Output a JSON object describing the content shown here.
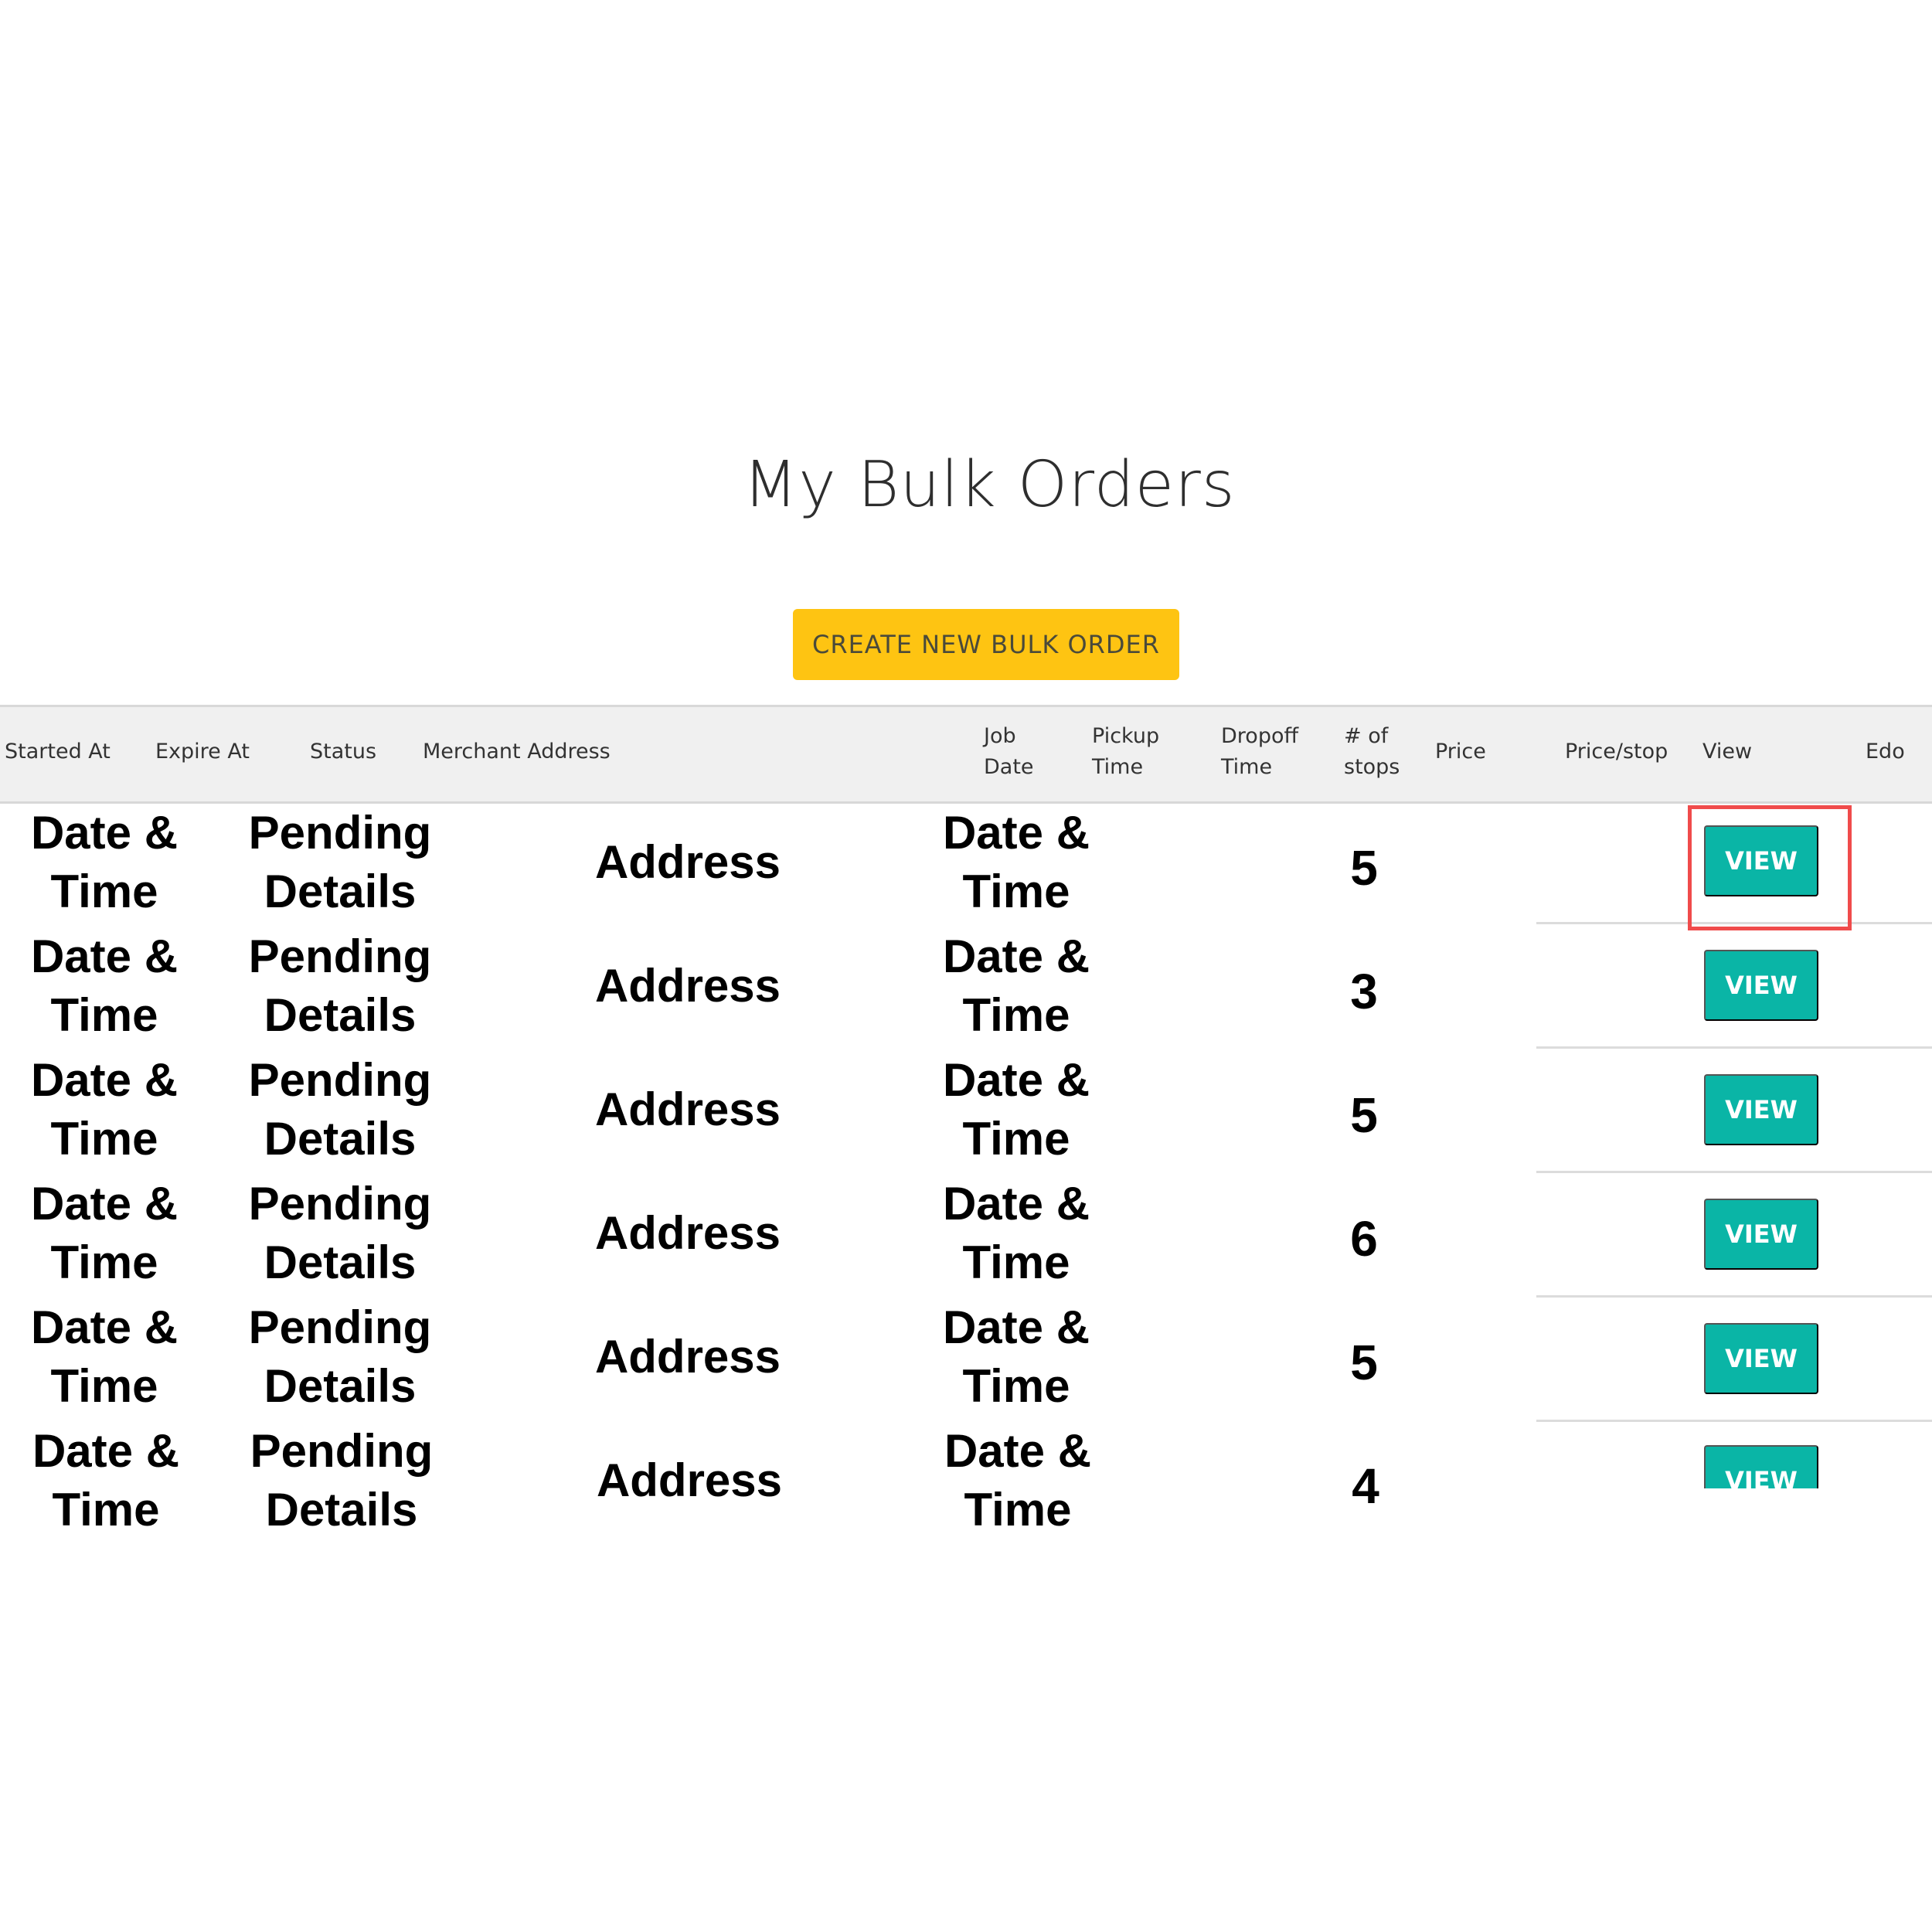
{
  "page": {
    "title": "My Bulk Orders",
    "create_button_label": "CREATE NEW BULK ORDER"
  },
  "table": {
    "headers": [
      "Started At",
      "Expire At",
      "Status",
      "Merchant Address",
      "Job\nDate",
      "Pickup\nTime",
      "Dropoff\nTime",
      "# of\nstops",
      "Price",
      "Price/stop",
      "View",
      "Edo"
    ],
    "rows": [
      {
        "started": "Date &\nTime",
        "status": "Pending\nDetails",
        "address": "Address",
        "job_date": "Date &\nTime",
        "stops": "5",
        "view_label": "VIEW"
      },
      {
        "started": "Date &\nTime",
        "status": "Pending\nDetails",
        "address": "Address",
        "job_date": "Date &\nTime",
        "stops": "3",
        "view_label": "VIEW"
      },
      {
        "started": "Date &\nTime",
        "status": "Pending\nDetails",
        "address": "Address",
        "job_date": "Date &\nTime",
        "stops": "5",
        "view_label": "VIEW"
      },
      {
        "started": "Date &\nTime",
        "status": "Pending\nDetails",
        "address": "Address",
        "job_date": "Date &\nTime",
        "stops": "6",
        "view_label": "VIEW"
      },
      {
        "started": "Date &\nTime",
        "status": "Pending\nDetails",
        "address": "Address",
        "job_date": "Date &\nTime",
        "stops": "5",
        "view_label": "VIEW"
      },
      {
        "started": "Date &\nTime",
        "status": "Pending\nDetails",
        "address": "Address",
        "job_date": "Date &\nTime",
        "stops": "4",
        "view_label": "VIEW"
      }
    ]
  },
  "colors": {
    "create_button": "#fec412",
    "view_button": "#0ab5a6",
    "highlight": "#f04b4b",
    "header_background": "#f0f0f0"
  }
}
